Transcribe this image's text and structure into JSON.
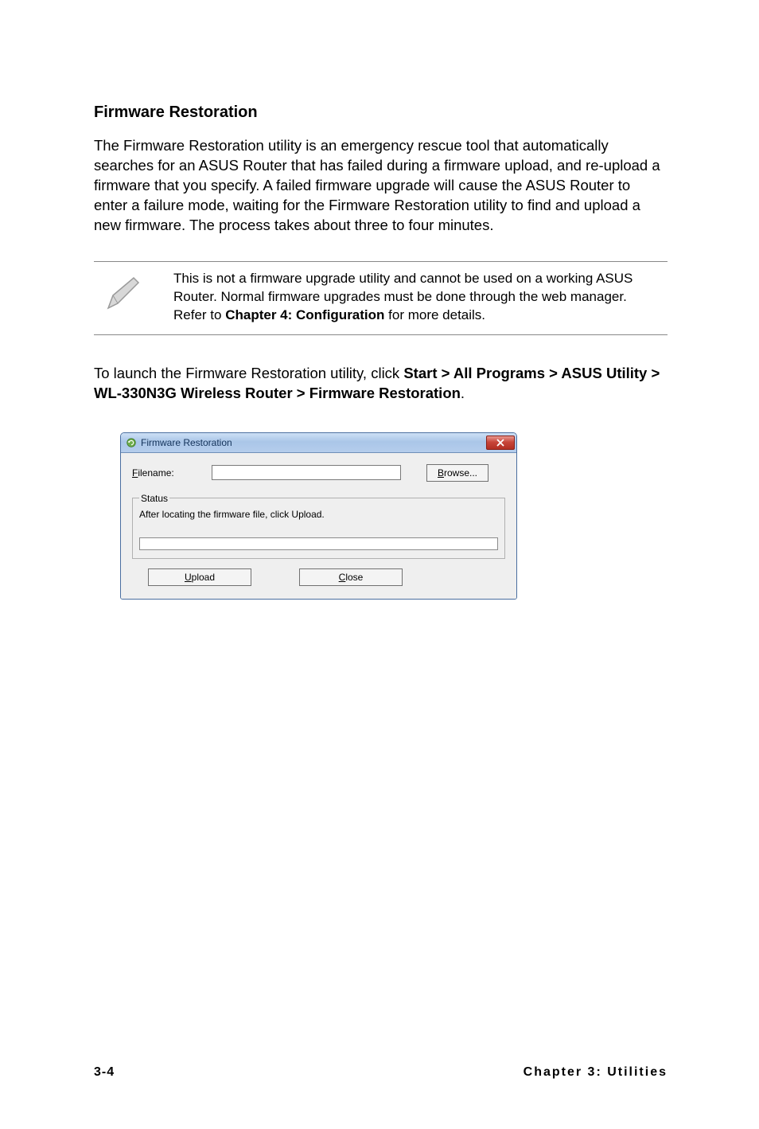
{
  "section_heading": "Firmware Restoration",
  "intro_para": "The Firmware Restoration utility is an emergency rescue tool that automatically searches for an ASUS Router that has failed during a firmware upload, and re-upload a firmware that you specify. A failed firmware upgrade will cause the ASUS Router to enter a failure mode, waiting for the Firmware Restoration utility to find and upload a new firmware. The process takes about three to four minutes.",
  "note": {
    "text_before": "This is not a firmware upgrade utility and cannot be used on a working ASUS Router. Normal firmware upgrades must be done through the web manager. Refer to ",
    "bold": "Chapter 4: Configuration",
    "text_after": " for more details."
  },
  "launch": {
    "text_before": "To launch the Firmware Restoration utility, click ",
    "bold": "Start > All Programs > ASUS Utility > WL-330N3G Wireless Router > Firmware Restoration",
    "text_after": "."
  },
  "dialog": {
    "title": "Firmware Restoration",
    "filename_label_u": "F",
    "filename_label_rest": "ilename:",
    "filename_value": "",
    "browse_u": "B",
    "browse_rest": "rowse...",
    "status_legend": "Status",
    "status_text": "After locating the firmware file, click Upload.",
    "upload_u": "U",
    "upload_rest": "pload",
    "close_u": "C",
    "close_rest": "lose"
  },
  "footer": {
    "page": "3-4",
    "chapter": "Chapter 3: Utilities"
  }
}
